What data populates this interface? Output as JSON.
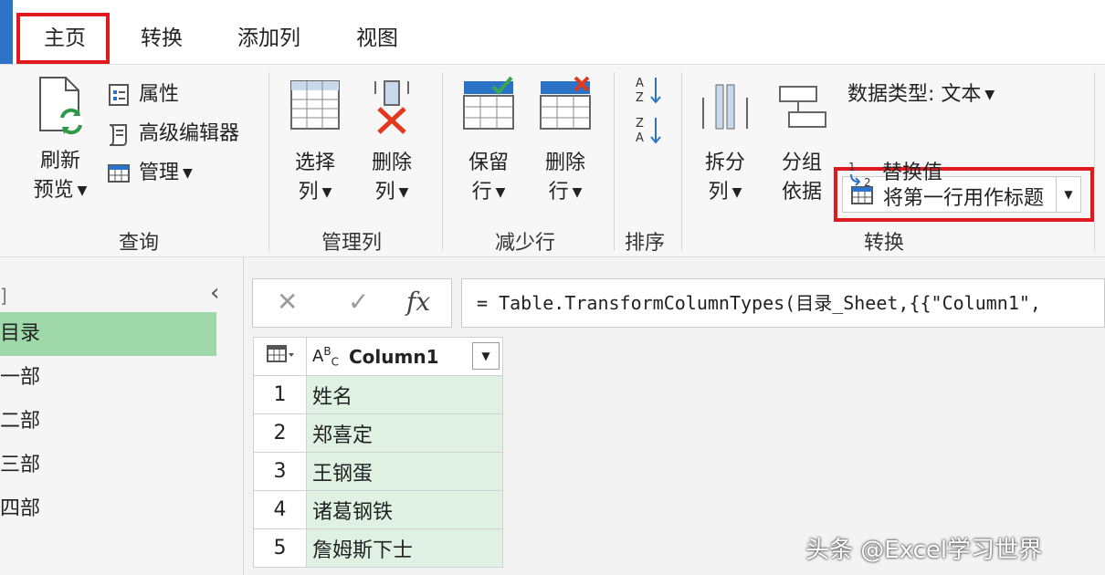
{
  "tabs": {
    "home": "主页",
    "convert": "转换",
    "add_column": "添加列",
    "view": "视图"
  },
  "ribbon": {
    "query": {
      "label": "查询",
      "refresh_line1": "刷新",
      "refresh_line2": "预览",
      "properties": "属性",
      "advanced_editor": "高级编辑器",
      "manage": "管理"
    },
    "manage_columns": {
      "label": "管理列",
      "choose_line1": "选择",
      "choose_line2": "列",
      "remove_line1": "删除",
      "remove_line2": "列"
    },
    "reduce_rows": {
      "label": "减少行",
      "keep_line1": "保留",
      "keep_line2": "行",
      "remove_line1": "删除",
      "remove_line2": "行"
    },
    "sort": {
      "label": "排序"
    },
    "transform": {
      "label": "转换",
      "split_line1": "拆分",
      "split_line2": "列",
      "group_line1": "分组",
      "group_line2": "依据",
      "data_type": "数据类型: 文本",
      "use_first_row": "将第一行用作标题",
      "replace_values": "替换值"
    }
  },
  "queries": {
    "items": [
      "目录",
      "一部",
      "二部",
      "三部",
      "四部"
    ],
    "selected": "目录"
  },
  "formula_bar": {
    "expression": "= Table.TransformColumnTypes(目录_Sheet,{{\"Column1\","
  },
  "grid": {
    "column_header": "Column1",
    "type_icon": "ABC",
    "rows": [
      {
        "n": "1",
        "v": "姓名"
      },
      {
        "n": "2",
        "v": "郑喜定"
      },
      {
        "n": "3",
        "v": "王钢蛋"
      },
      {
        "n": "4",
        "v": "诸葛钢铁"
      },
      {
        "n": "5",
        "v": "詹姆斯下士"
      }
    ]
  },
  "watermark": "头条 @Excel学习世界",
  "colors": {
    "highlight_red": "#e0191f",
    "accent_blue": "#2b73c6",
    "selected_query": "#9fd9a9",
    "cell_green": "#dff1e2"
  }
}
